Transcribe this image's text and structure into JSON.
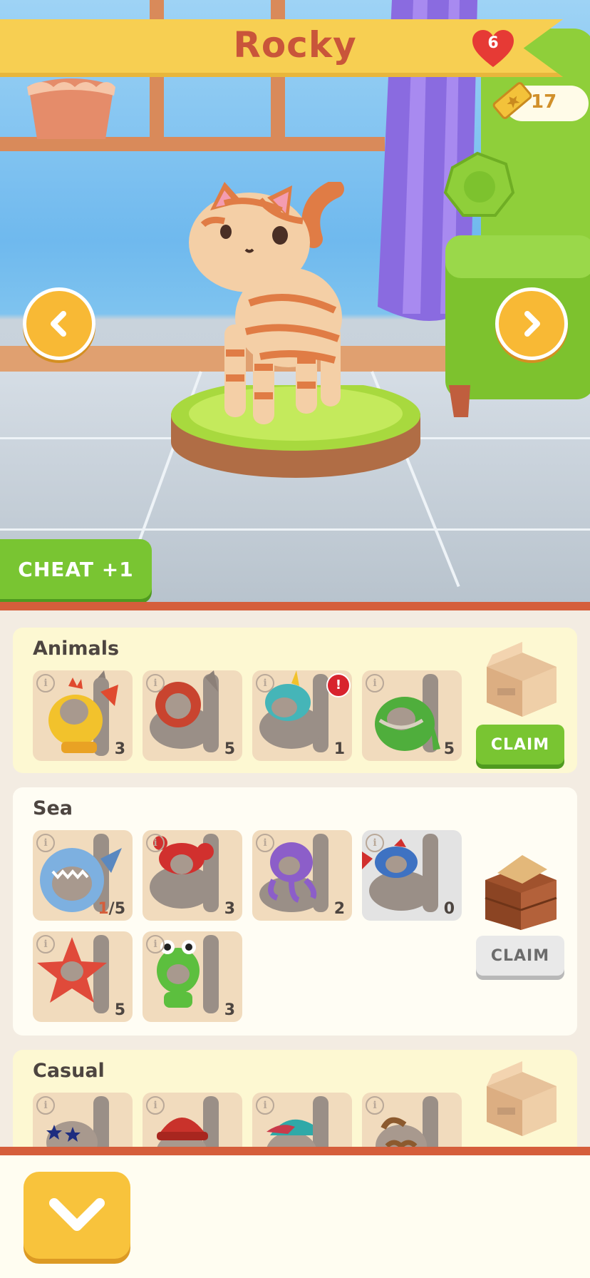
{
  "header": {
    "pet_name": "Rocky",
    "hearts": "6",
    "tickets": "17"
  },
  "scene": {
    "cheat_label": "CHEAT +1"
  },
  "collections": [
    {
      "title": "Animals",
      "claim_label": "CLAIM",
      "claim_state": "active",
      "items": [
        {
          "name": "chick-costume",
          "count": "3",
          "locked": false,
          "alert": false
        },
        {
          "name": "lion-costume",
          "count": "5",
          "locked": false,
          "alert": false
        },
        {
          "name": "unicorn-costume",
          "count": "1",
          "locked": false,
          "alert": true,
          "alert_text": "!"
        },
        {
          "name": "dino-costume",
          "count": "5",
          "locked": false,
          "alert": false
        }
      ]
    },
    {
      "title": "Sea",
      "claim_label": "CLAIM",
      "claim_state": "inactive",
      "items": [
        {
          "name": "shark-costume",
          "count_have": "1",
          "count_total": "/5",
          "locked": false
        },
        {
          "name": "crab-costume",
          "count": "3",
          "locked": false
        },
        {
          "name": "octopus-costume",
          "count": "2",
          "locked": false
        },
        {
          "name": "fish-costume",
          "count": "0",
          "locked": true
        },
        {
          "name": "starfish-costume",
          "count": "5",
          "locked": false
        },
        {
          "name": "frog-costume",
          "count": "3",
          "locked": false
        }
      ]
    },
    {
      "title": "Casual",
      "items": [
        {
          "name": "star-sunglasses"
        },
        {
          "name": "beanie-hat"
        },
        {
          "name": "cap-hat"
        },
        {
          "name": "mustache"
        }
      ]
    }
  ],
  "colors": {
    "accent_green": "#79c532",
    "accent_orange": "#d55e3b",
    "gold": "#f8b935",
    "card_cream": "#fdf8d2",
    "card_white": "#fffdf4"
  }
}
